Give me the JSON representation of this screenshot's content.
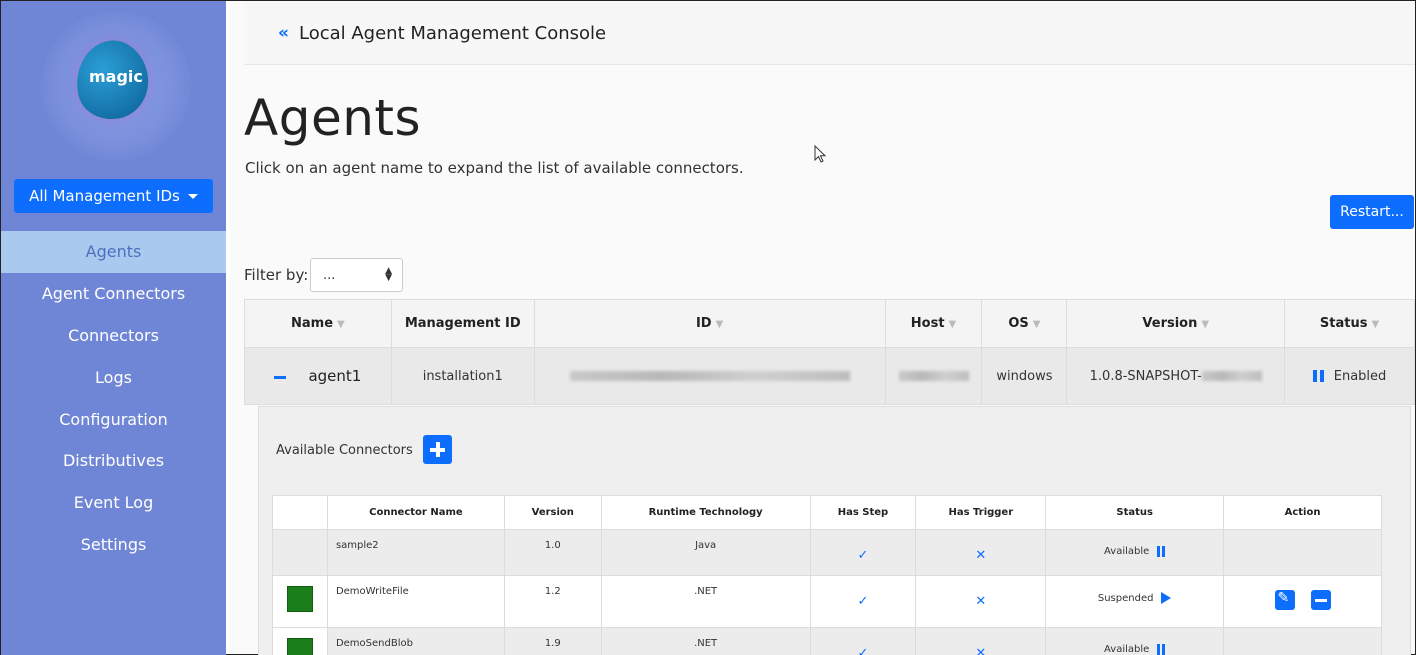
{
  "sidebar": {
    "logo_text": "magic",
    "management_dropdown": "All Management IDs",
    "items": [
      {
        "label": "Agents",
        "active": true
      },
      {
        "label": "Agent Connectors"
      },
      {
        "label": "Connectors"
      },
      {
        "label": "Logs"
      },
      {
        "label": "Configuration"
      },
      {
        "label": "Distributives"
      },
      {
        "label": "Event Log"
      },
      {
        "label": "Settings"
      }
    ]
  },
  "header": {
    "back_glyph": "«",
    "title": "Local Agent Management Console"
  },
  "page": {
    "title": "Agents",
    "subtitle": "Click on an agent name to expand the list of available connectors.",
    "restart_label": "Restart...",
    "filter_label": "Filter by:",
    "filter_value": "..."
  },
  "agents_table": {
    "columns": [
      "Name",
      "Management ID",
      "ID",
      "Host",
      "OS",
      "Version",
      "Status"
    ],
    "rows": [
      {
        "name": "agent1",
        "management_id": "installation1",
        "os": "windows",
        "version": "1.0.8-SNAPSHOT-",
        "status": "Enabled"
      }
    ]
  },
  "connectors": {
    "label": "Available Connectors",
    "columns": [
      "Connector Name",
      "Version",
      "Runtime Technology",
      "Has Step",
      "Has Trigger",
      "Status",
      "Action"
    ],
    "rows": [
      {
        "name": "sample2",
        "version": "1.0",
        "runtime": "Java",
        "has_step": "✓",
        "has_trigger": "✕",
        "status": "Available"
      },
      {
        "name": "DemoWriteFile",
        "version": "1.2",
        "runtime": ".NET",
        "has_step": "✓",
        "has_trigger": "✕",
        "status": "Suspended"
      },
      {
        "name": "DemoSendBlob",
        "version": "1.9",
        "runtime": ".NET",
        "has_step": "✓",
        "has_trigger": "✕",
        "status": "Available"
      }
    ]
  },
  "colors": {
    "sidebar_bg": "#6f86d6",
    "accent": "#0d6efd",
    "active_nav_bg": "#aac9ee",
    "connector_icon": "#1a7f1a"
  }
}
